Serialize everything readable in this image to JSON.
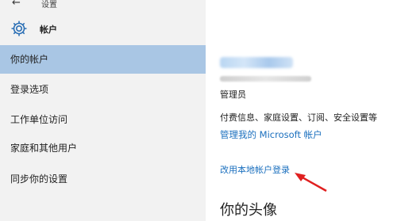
{
  "window": {
    "back_icon": "←",
    "title": "设置"
  },
  "section": {
    "title": "帐户",
    "icon": "gear-icon"
  },
  "sidebar": {
    "items": [
      {
        "label": "你的帐户",
        "active": true
      },
      {
        "label": "登录选项",
        "active": false
      },
      {
        "label": "工作单位访问",
        "active": false
      },
      {
        "label": "家庭和其他用户",
        "active": false
      },
      {
        "label": "同步你的设置",
        "active": false
      }
    ]
  },
  "main": {
    "role": "管理员",
    "billing_text": "付费信息、家庭设置、订阅、安全设置等",
    "manage_link": "管理我的 Microsoft 帐户",
    "local_link": "改用本地帐户登录",
    "avatar_heading": "你的头像"
  },
  "colors": {
    "accent": "#1a6fbe",
    "active_item": "#a9c6e4",
    "sidebar_bg": "#f2f2f2",
    "annotation_arrow": "#e02020"
  }
}
